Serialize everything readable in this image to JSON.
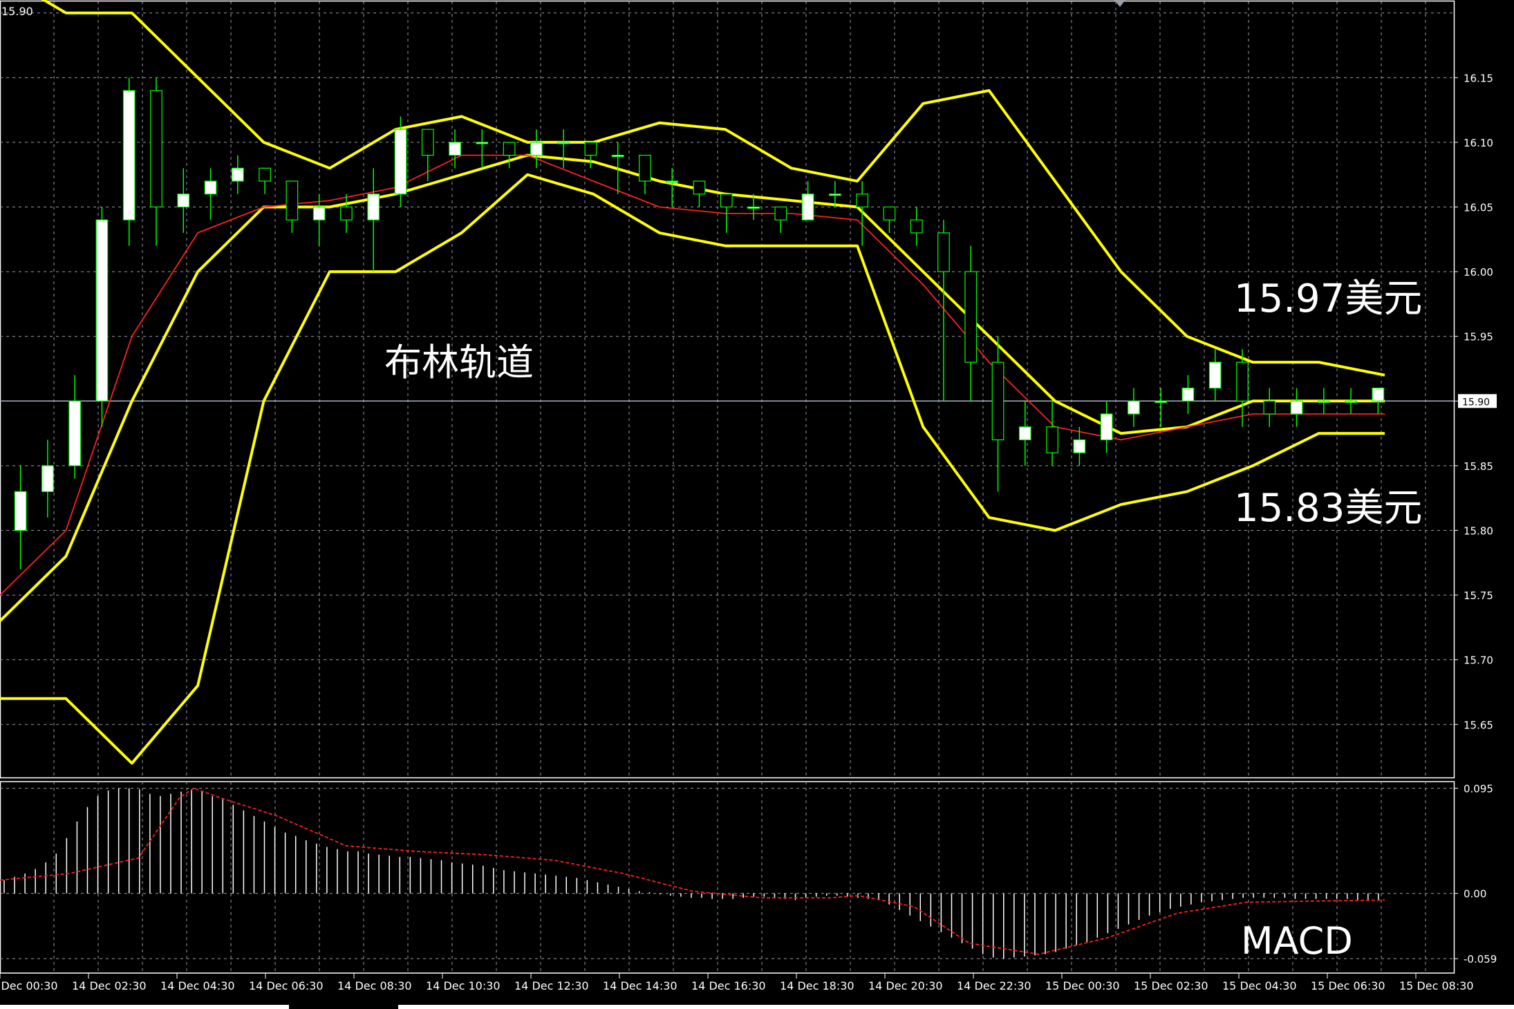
{
  "chart_data": [
    {
      "type": "candlestick",
      "symbol_price_label": "15.90",
      "indicator": "布林轨道",
      "colors": {
        "background": "#000000",
        "grid": "#9aa0a8",
        "candle_up": "#ffffff",
        "candle_down": "#000000",
        "candle_wick": "#00ff00",
        "bollinger": "#ffff00",
        "middle_ma": "#ff2020",
        "axis_text": "#ffffff",
        "current_price_line": "#aab4c8"
      },
      "ylim": [
        15.609,
        16.21
      ],
      "y_ticks": [
        "16.15",
        "16.10",
        "16.05",
        "16.00",
        "15.95",
        "15.90",
        "15.85",
        "15.80",
        "15.75",
        "15.70",
        "15.65"
      ],
      "current_price": "15.90",
      "annotations": [
        {
          "name": "upper-band-label",
          "text": "15.97美元"
        },
        {
          "name": "lower-band-label",
          "text": "15.83美元"
        },
        {
          "name": "indicator-label",
          "text": "布林轨道"
        }
      ],
      "x_tick_labels": [
        "14 Dec 00:30",
        "14 Dec 02:30",
        "14 Dec 04:30",
        "14 Dec 06:30",
        "14 Dec 08:30",
        "14 Dec 10:30",
        "14 Dec 12:30",
        "14 Dec 14:30",
        "14 Dec 16:30",
        "14 Dec 18:30",
        "14 Dec 20:30",
        "14 Dec 22:30",
        "15 Dec 00:30",
        "15 Dec 02:30",
        "15 Dec 04:30",
        "15 Dec 06:30",
        "15 Dec 08:30"
      ],
      "bollinger_upper": [
        [
          0,
          16.23
        ],
        [
          2,
          16.2
        ],
        [
          4,
          16.2
        ],
        [
          6,
          16.15
        ],
        [
          8,
          16.1
        ],
        [
          10,
          16.08
        ],
        [
          12,
          16.11
        ],
        [
          14,
          16.12
        ],
        [
          16,
          16.1
        ],
        [
          18,
          16.1
        ],
        [
          20,
          16.115
        ],
        [
          22,
          16.11
        ],
        [
          24,
          16.08
        ],
        [
          26,
          16.07
        ],
        [
          28,
          16.13
        ],
        [
          30,
          16.14
        ],
        [
          32,
          16.07
        ],
        [
          34,
          16.0
        ],
        [
          36,
          15.95
        ],
        [
          38,
          15.93
        ],
        [
          40,
          15.93
        ],
        [
          42,
          15.92
        ]
      ],
      "bollinger_middle": [
        [
          0,
          15.73
        ],
        [
          2,
          15.78
        ],
        [
          4,
          15.9
        ],
        [
          6,
          16.0
        ],
        [
          8,
          16.05
        ],
        [
          10,
          16.05
        ],
        [
          12,
          16.06
        ],
        [
          14,
          16.075
        ],
        [
          16,
          16.09
        ],
        [
          18,
          16.085
        ],
        [
          20,
          16.07
        ],
        [
          22,
          16.06
        ],
        [
          24,
          16.055
        ],
        [
          26,
          16.05
        ],
        [
          28,
          16.0
        ],
        [
          30,
          15.95
        ],
        [
          32,
          15.9
        ],
        [
          34,
          15.875
        ],
        [
          36,
          15.88
        ],
        [
          38,
          15.9
        ],
        [
          40,
          15.9
        ],
        [
          42,
          15.9
        ]
      ],
      "bollinger_lower": [
        [
          0,
          15.67
        ],
        [
          2,
          15.67
        ],
        [
          4,
          15.62
        ],
        [
          6,
          15.68
        ],
        [
          8,
          15.9
        ],
        [
          10,
          16.0
        ],
        [
          12,
          16.0
        ],
        [
          14,
          16.03
        ],
        [
          16,
          16.075
        ],
        [
          18,
          16.06
        ],
        [
          20,
          16.03
        ],
        [
          22,
          16.02
        ],
        [
          24,
          16.02
        ],
        [
          26,
          16.02
        ],
        [
          28,
          15.88
        ],
        [
          30,
          15.81
        ],
        [
          32,
          15.8
        ],
        [
          34,
          15.82
        ],
        [
          36,
          15.83
        ],
        [
          38,
          15.85
        ],
        [
          40,
          15.875
        ],
        [
          42,
          15.875
        ]
      ],
      "middle_ma": [
        [
          0,
          15.75
        ],
        [
          2,
          15.8
        ],
        [
          4,
          15.95
        ],
        [
          6,
          16.03
        ],
        [
          8,
          16.05
        ],
        [
          10,
          16.055
        ],
        [
          12,
          16.065
        ],
        [
          14,
          16.09
        ],
        [
          16,
          16.09
        ],
        [
          18,
          16.07
        ],
        [
          20,
          16.05
        ],
        [
          22,
          16.045
        ],
        [
          24,
          16.045
        ],
        [
          26,
          16.04
        ],
        [
          28,
          15.99
        ],
        [
          30,
          15.93
        ],
        [
          32,
          15.88
        ],
        [
          34,
          15.87
        ],
        [
          36,
          15.88
        ],
        [
          38,
          15.89
        ],
        [
          40,
          15.89
        ],
        [
          42,
          15.89
        ]
      ],
      "candles": [
        [
          15.8,
          15.83,
          15.77,
          15.85
        ],
        [
          15.83,
          15.85,
          15.81,
          15.87
        ],
        [
          15.85,
          15.9,
          15.84,
          15.92
        ],
        [
          15.9,
          16.04,
          15.88,
          16.05
        ],
        [
          16.04,
          16.14,
          16.02,
          16.15
        ],
        [
          16.14,
          16.05,
          16.02,
          16.15
        ],
        [
          16.05,
          16.06,
          16.03,
          16.08
        ],
        [
          16.06,
          16.07,
          16.04,
          16.08
        ],
        [
          16.07,
          16.08,
          16.06,
          16.09
        ],
        [
          16.08,
          16.07,
          16.06,
          16.08
        ],
        [
          16.07,
          16.04,
          16.03,
          16.07
        ],
        [
          16.04,
          16.05,
          16.02,
          16.06
        ],
        [
          16.05,
          16.04,
          16.03,
          16.06
        ],
        [
          16.04,
          16.06,
          16.0,
          16.08
        ],
        [
          16.06,
          16.11,
          16.05,
          16.12
        ],
        [
          16.11,
          16.09,
          16.07,
          16.11
        ],
        [
          16.09,
          16.1,
          16.08,
          16.11
        ],
        [
          16.1,
          16.1,
          16.08,
          16.11
        ],
        [
          16.1,
          16.09,
          16.08,
          16.1
        ],
        [
          16.09,
          16.1,
          16.08,
          16.11
        ],
        [
          16.1,
          16.1,
          16.08,
          16.11
        ],
        [
          16.1,
          16.09,
          16.08,
          16.1
        ],
        [
          16.09,
          16.09,
          16.06,
          16.1
        ],
        [
          16.09,
          16.07,
          16.06,
          16.08
        ],
        [
          16.07,
          16.07,
          16.05,
          16.08
        ],
        [
          16.07,
          16.06,
          16.05,
          16.07
        ],
        [
          16.06,
          16.05,
          16.03,
          16.06
        ],
        [
          16.05,
          16.05,
          16.04,
          16.06
        ],
        [
          16.05,
          16.04,
          16.03,
          16.05
        ],
        [
          16.04,
          16.06,
          16.04,
          16.07
        ],
        [
          16.06,
          16.06,
          16.05,
          16.07
        ],
        [
          16.06,
          16.05,
          16.02,
          16.07
        ],
        [
          16.05,
          16.04,
          16.03,
          16.05
        ],
        [
          16.04,
          16.03,
          16.02,
          16.05
        ],
        [
          16.03,
          16.0,
          15.9,
          16.04
        ],
        [
          16.0,
          15.93,
          15.9,
          16.02
        ],
        [
          15.93,
          15.87,
          15.83,
          15.95
        ],
        [
          15.87,
          15.88,
          15.85,
          15.9
        ],
        [
          15.88,
          15.86,
          15.85,
          15.9
        ],
        [
          15.86,
          15.87,
          15.85,
          15.88
        ],
        [
          15.87,
          15.89,
          15.86,
          15.9
        ],
        [
          15.89,
          15.9,
          15.88,
          15.91
        ],
        [
          15.9,
          15.9,
          15.88,
          15.91
        ],
        [
          15.9,
          15.91,
          15.89,
          15.92
        ],
        [
          15.91,
          15.93,
          15.9,
          15.94
        ],
        [
          15.93,
          15.9,
          15.88,
          15.94
        ],
        [
          15.9,
          15.89,
          15.88,
          15.91
        ],
        [
          15.89,
          15.9,
          15.88,
          15.91
        ],
        [
          15.9,
          15.9,
          15.89,
          15.91
        ],
        [
          15.9,
          15.9,
          15.89,
          15.91
        ],
        [
          15.9,
          15.91,
          15.89,
          15.91
        ]
      ]
    },
    {
      "type": "bar",
      "indicator": "MACD",
      "ylim": [
        -0.072,
        0.101
      ],
      "y_ticks": [
        "0.095",
        "0.00",
        "-0.059"
      ],
      "colors": {
        "histogram": "#ffffff",
        "signal": "#ff2020"
      },
      "histogram": [
        0.012,
        0.015,
        0.018,
        0.022,
        0.028,
        0.036,
        0.05,
        0.065,
        0.078,
        0.088,
        0.093,
        0.095,
        0.095,
        0.094,
        0.09,
        0.088,
        0.09,
        0.092,
        0.094,
        0.092,
        0.088,
        0.085,
        0.08,
        0.075,
        0.07,
        0.065,
        0.06,
        0.055,
        0.052,
        0.048,
        0.045,
        0.042,
        0.04,
        0.038,
        0.038,
        0.036,
        0.035,
        0.034,
        0.033,
        0.033,
        0.032,
        0.031,
        0.03,
        0.028,
        0.027,
        0.026,
        0.025,
        0.023,
        0.021,
        0.02,
        0.019,
        0.018,
        0.017,
        0.016,
        0.015,
        0.014,
        0.012,
        0.01,
        0.008,
        0.006,
        0.004,
        0.002,
        0.001,
        -0.001,
        -0.002,
        -0.003,
        -0.004,
        -0.004,
        -0.005,
        -0.005,
        -0.005,
        -0.004,
        -0.003,
        -0.003,
        -0.004,
        -0.005,
        -0.006,
        -0.004,
        -0.003,
        -0.002,
        -0.002,
        -0.003,
        -0.004,
        -0.005,
        -0.006,
        -0.01,
        -0.015,
        -0.02,
        -0.025,
        -0.03,
        -0.035,
        -0.04,
        -0.045,
        -0.05,
        -0.055,
        -0.058,
        -0.059,
        -0.058,
        -0.057,
        -0.056,
        -0.055,
        -0.053,
        -0.05,
        -0.047,
        -0.044,
        -0.04,
        -0.036,
        -0.032,
        -0.028,
        -0.024,
        -0.02,
        -0.017,
        -0.014,
        -0.012,
        -0.01,
        -0.008,
        -0.007,
        -0.006,
        -0.005,
        -0.004,
        -0.004,
        -0.004,
        -0.004,
        -0.004,
        -0.005,
        -0.005,
        -0.005,
        -0.005,
        -0.005,
        -0.005,
        -0.006,
        -0.006,
        -0.006
      ],
      "signal": [
        [
          0,
          0.012
        ],
        [
          0.05,
          0.018
        ],
        [
          0.1,
          0.032
        ],
        [
          0.13,
          0.087
        ],
        [
          0.14,
          0.095
        ],
        [
          0.16,
          0.086
        ],
        [
          0.2,
          0.07
        ],
        [
          0.25,
          0.043
        ],
        [
          0.3,
          0.038
        ],
        [
          0.35,
          0.035
        ],
        [
          0.4,
          0.03
        ],
        [
          0.45,
          0.018
        ],
        [
          0.5,
          0.002
        ],
        [
          0.55,
          -0.004
        ],
        [
          0.6,
          -0.004
        ],
        [
          0.62,
          -0.002
        ],
        [
          0.66,
          -0.012
        ],
        [
          0.7,
          -0.045
        ],
        [
          0.75,
          -0.055
        ],
        [
          0.8,
          -0.04
        ],
        [
          0.85,
          -0.018
        ],
        [
          0.9,
          -0.008
        ],
        [
          0.95,
          -0.007
        ],
        [
          1,
          -0.006
        ]
      ]
    }
  ]
}
